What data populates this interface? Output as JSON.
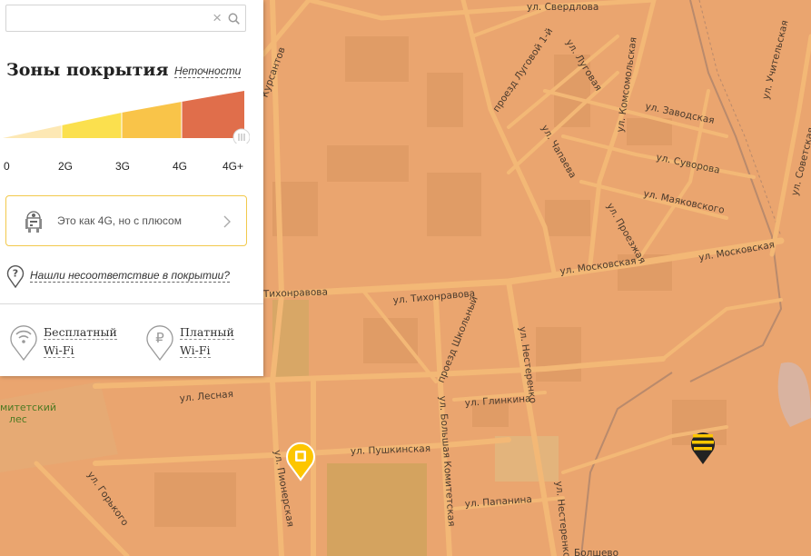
{
  "search": {
    "value": "",
    "placeholder": ""
  },
  "coverage": {
    "title": "Зоны покрытия",
    "inaccuracy_link": "Неточности",
    "levels": [
      {
        "label": "0",
        "color": "#fde8b4"
      },
      {
        "label": "2G",
        "color": "#fbe04e"
      },
      {
        "label": "3G",
        "color": "#f9c449"
      },
      {
        "label": "4G",
        "color": "#e06e4b"
      },
      {
        "label": "4G+",
        "color": "#e06e4b"
      }
    ]
  },
  "promo": {
    "text": "Это как 4G, но с плюсом",
    "icon": "robot-icon"
  },
  "report": {
    "link": "Нашли несоответствие в покрытии?"
  },
  "wifi": {
    "free": {
      "line1": "Бесплатный",
      "line2": "Wi-Fi"
    },
    "paid": {
      "line1": "Платный",
      "line2": "Wi-Fi"
    }
  },
  "map": {
    "forest_label": [
      "митетский",
      "лес"
    ],
    "streets": [
      "ул. Свердлова",
      "ул. Луговая",
      "проезд Луговой 1-й",
      "ул. Комсомольская",
      "ул. Заводская",
      "ул. Суворова",
      "ул. Маяковского",
      "ул. Чапаева",
      "ул. Проезжая",
      "ул. Московская",
      "ул. Тихонравова",
      "Тихонравова",
      "проезд Школьный",
      "ул. Нестеренко",
      "ул. Глинкина",
      "ул. Лесная",
      "ул. Пушкинская",
      "ул. Пионерская",
      "ул. Большая Комитетская",
      "ул. Папанина",
      "ул. Горького",
      "ул. Советская",
      "ул. Учительская",
      "Курсантов",
      "Болшево"
    ],
    "colors": {
      "background": "#eaa56f",
      "roads": "#f3b876",
      "pin_yellow": "#fdc600",
      "pin_black": "#222222"
    }
  }
}
